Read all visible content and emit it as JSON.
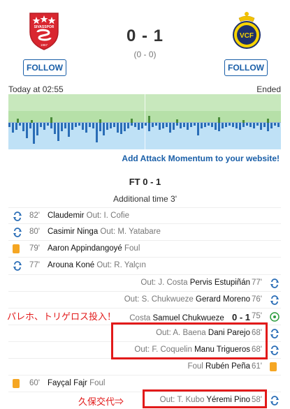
{
  "header": {
    "home_team_crest_text": "SIVASSPOR",
    "home_team_crest_year": "1967",
    "away_team_crest_text": "VCF",
    "score": "0 - 1",
    "halftime": "(0 - 0)",
    "home_follow": "FOLLOW",
    "away_follow": "FOLLOW"
  },
  "meta": {
    "kickoff": "Today at 02:55",
    "status": "Ended"
  },
  "momentum": {
    "cta": "Add Attack Momentum to your website!",
    "colors": {
      "home": "#c8e8bd",
      "away": "#bfe1f6",
      "bars": "#2a6db6"
    }
  },
  "timeline": {
    "title": "FT 0 - 1",
    "added_time": "Additional time 3'",
    "events": [
      {
        "side": "home",
        "minute": "82'",
        "type": "substitution",
        "player": "Claudemir",
        "detail": "Out: I. Cofie"
      },
      {
        "side": "home",
        "minute": "80'",
        "type": "substitution",
        "player": "Casimir Ninga",
        "detail": "Out: M. Yatabare"
      },
      {
        "side": "home",
        "minute": "79'",
        "type": "yellow-card",
        "player": "Aaron Appindangoyé",
        "detail": "Foul"
      },
      {
        "side": "home",
        "minute": "77'",
        "type": "substitution",
        "player": "Arouna Koné",
        "detail": "Out: R. Yalçın"
      },
      {
        "side": "away",
        "minute": "77'",
        "type": "substitution",
        "player": "Pervis Estupiñán",
        "detail": "Out: J. Costa"
      },
      {
        "side": "away",
        "minute": "76'",
        "type": "substitution",
        "player": "Gerard Moreno",
        "detail": "Out: S. Chukwueze"
      },
      {
        "side": "away",
        "minute": "75'",
        "type": "goal",
        "player": "Samuel Chukwueze",
        "detail": "Costa",
        "score": "0 - 1"
      },
      {
        "side": "away",
        "minute": "68'",
        "type": "substitution",
        "player": "Dani Parejo",
        "detail": "Out: A. Baena"
      },
      {
        "side": "away",
        "minute": "68'",
        "type": "substitution",
        "player": "Manu Trigueros",
        "detail": "Out: F. Coquelin"
      },
      {
        "side": "away",
        "minute": "61'",
        "type": "yellow-card",
        "player": "Rubén Peña",
        "detail": "Foul"
      },
      {
        "side": "home",
        "minute": "60'",
        "type": "yellow-card",
        "player": "Fayçal Fajr",
        "detail": "Foul"
      },
      {
        "side": "away",
        "minute": "58'",
        "type": "substitution",
        "player": "Yéremi Pino",
        "detail": "Out: T. Kubo"
      }
    ]
  },
  "annotations": {
    "parejo_trigueros": "パレホ、トリゲロス投入！",
    "kubo": "久保交代⇒"
  }
}
